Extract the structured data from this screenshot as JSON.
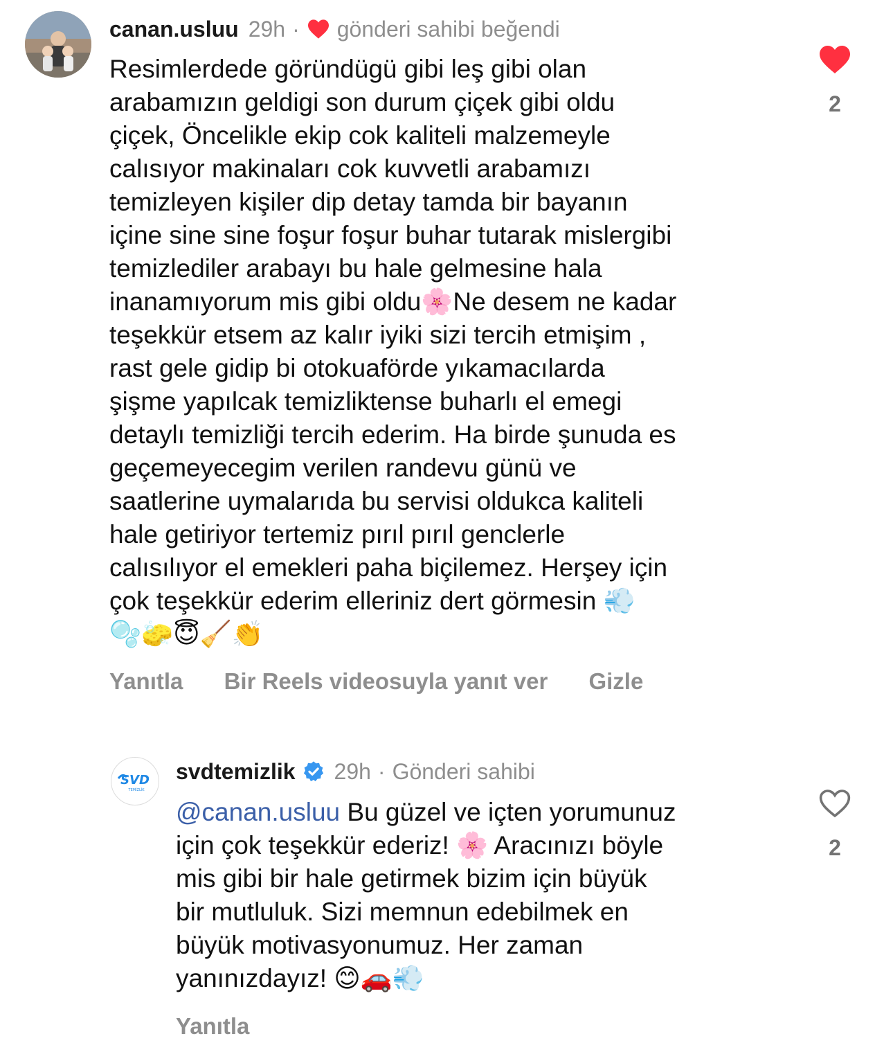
{
  "comments": [
    {
      "username": "canan.usluu",
      "time": "29h",
      "separator": "·",
      "liked_by_author_label": "gönderi sahibi beğendi",
      "text_lines": [
        "Resimlerdede göründügü gibi leş gibi olan",
        "arabamızın geldigi son durum çiçek gibi oldu",
        "çiçek, Öncelikle ekip cok kaliteli malzemeyle",
        "calısıyor makinaları cok kuvvetli arabamızı",
        "temizleyen kişiler dip detay tamda bir bayanın",
        "içine sine sine foşur foşur buhar tutarak mislergibi",
        "temizlediler arabayı bu hale gelmesine hala",
        "inanamıyorum mis gibi oldu🌸Ne desem ne kadar",
        "teşekkür etsem az kalır iyiki sizi tercih etmişim ,",
        "rast gele gidip bi otokuaförde yıkamacılarda",
        "şişme yapılcak temizliktense buharlı el emegi",
        "detaylı temizliği tercih ederim. Ha birde şunuda es",
        "geçemeyecegim verilen randevu günü ve",
        "saatlerine uymalarıda bu servisi oldukca kaliteli",
        "hale getiriyor tertemiz pırıl pırıl genclerle",
        "calısılıyor el emekleri paha biçilemez. Herşey için",
        "çok teşekkür ederim elleriniz dert görmesin 💨",
        "🫧🧽😇🧹👏"
      ],
      "actions": {
        "reply": "Yanıtla",
        "reels_reply": "Bir Reels videosuyla yanıt ver",
        "hide": "Gizle"
      },
      "like_count": "2",
      "liked": true,
      "like_color": "#ff3040"
    },
    {
      "username": "svdtemizlik",
      "verified": true,
      "time": "29h",
      "separator": "·",
      "author_label": "Gönderi sahibi",
      "mention": "@canan.usluu",
      "text_lines": [
        " Bu güzel ve içten yorumunuz",
        "için çok teşekkür ederiz! 🌸 Aracınızı böyle",
        "mis gibi bir hale getirmek bizim için büyük",
        "bir mutluluk. Sizi memnun edebilmek en",
        "büyük motivasyonumuz. Her zaman",
        "yanınızdayız! 😊🚗💨"
      ],
      "actions": {
        "reply": "Yanıtla"
      },
      "like_count": "2",
      "liked": false,
      "brand_logo_text": "SVD",
      "brand_logo_subtext": "TEMİZLİK",
      "brand_color": "#1e88e5",
      "verified_color": "#3897f0"
    }
  ]
}
